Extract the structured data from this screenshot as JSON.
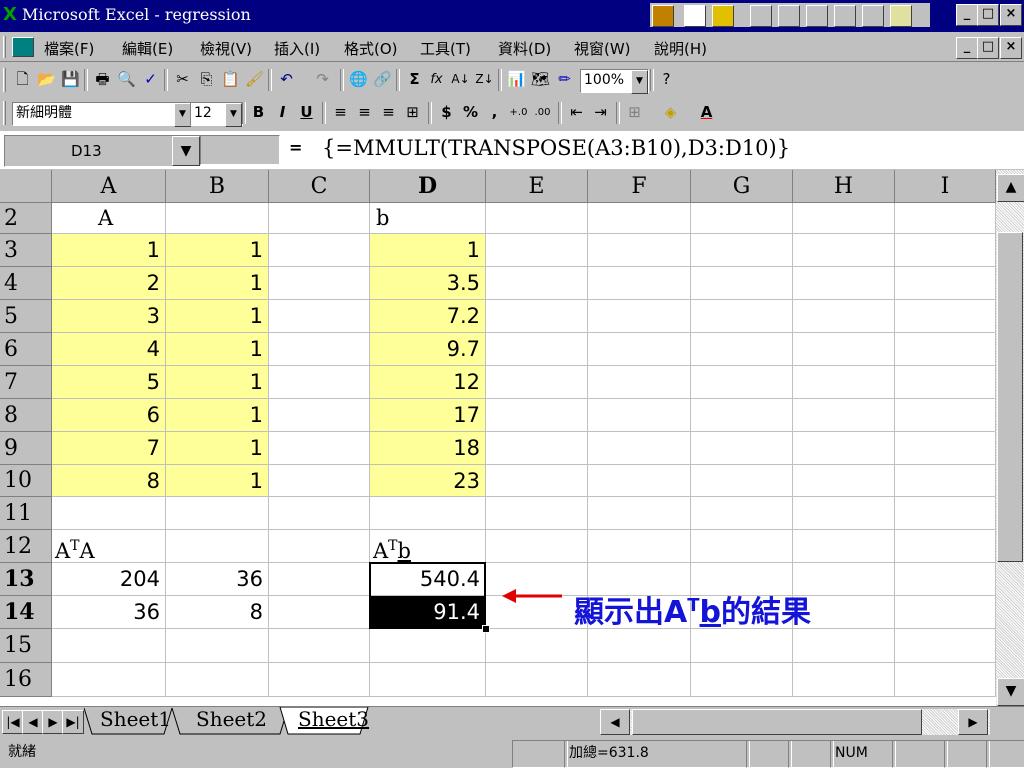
{
  "window": {
    "title": "Microsoft Excel - regression",
    "app_icon": "excel-icon",
    "controls": {
      "minimize": "_",
      "maximize": "□",
      "close": "×"
    }
  },
  "menu": {
    "items": [
      "檔案(F)",
      "編輯(E)",
      "檢視(V)",
      "插入(I)",
      "格式(O)",
      "工具(T)",
      "資料(D)",
      "視窗(W)",
      "說明(H)"
    ]
  },
  "toolbar": {
    "zoom": "100%",
    "font_name": "新細明體",
    "font_size": "12",
    "bold": "B",
    "italic": "I",
    "underline": "U",
    "currency": "$",
    "percent": "%",
    "comma": ",",
    "sum": "Σ",
    "fx": "fx"
  },
  "formula_bar": {
    "name_box": "D13",
    "equals": "=",
    "formula": "{=MMULT(TRANSPOSE(A3:B10),D3:D10)}"
  },
  "grid": {
    "columns": [
      "A",
      "B",
      "C",
      "D",
      "E",
      "F",
      "G",
      "H",
      "I"
    ],
    "rows": [
      "2",
      "3",
      "4",
      "5",
      "6",
      "7",
      "8",
      "9",
      "10",
      "11",
      "12",
      "13",
      "14",
      "15",
      "16"
    ],
    "cells": {
      "A2": "A",
      "D2": "b",
      "A": [
        "1",
        "2",
        "3",
        "4",
        "5",
        "6",
        "7",
        "8"
      ],
      "B": [
        "1",
        "1",
        "1",
        "1",
        "1",
        "1",
        "1",
        "1"
      ],
      "D": [
        "1",
        "3.5",
        "7.2",
        "9.7",
        "12",
        "17",
        "18",
        "23"
      ],
      "A12_base": "A",
      "A12_sup": "T",
      "A12_tail": "A",
      "D12_base": "A",
      "D12_sup": "T",
      "D12_tail": "b",
      "A13": "204",
      "B13": "36",
      "A14": "36",
      "B14": "8",
      "D13": "540.4",
      "D14": "91.4"
    },
    "selection": "D13:D14"
  },
  "annotation": {
    "prefix": "顯示出A",
    "sup": "T",
    "mid": "b",
    "suffix": "的結果",
    "color": "#1414d8",
    "arrow_color": "#e00000"
  },
  "sheet_tabs": [
    "Sheet1",
    "Sheet2",
    "Sheet3"
  ],
  "active_sheet": "Sheet3",
  "status": {
    "ready": "就緒",
    "sum": "加總=631.8",
    "num": "NUM"
  }
}
